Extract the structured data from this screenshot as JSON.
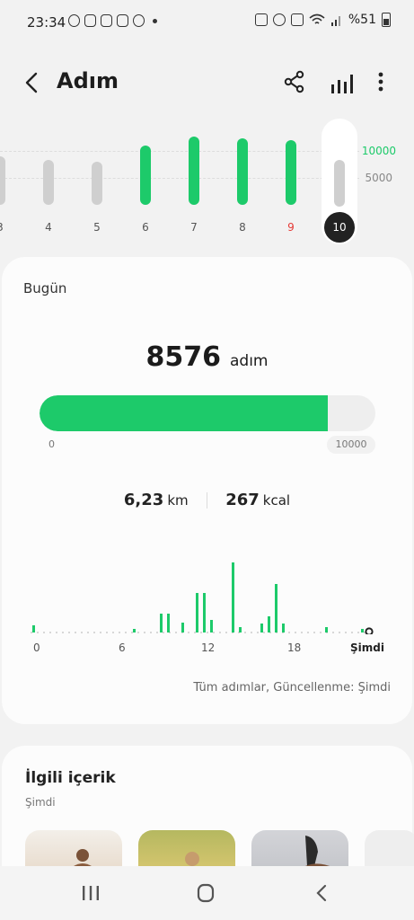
{
  "status_bar": {
    "time": "23:34",
    "battery": "%51"
  },
  "header": {
    "title": "Adım"
  },
  "weekly": {
    "days": [
      "3",
      "4",
      "5",
      "6",
      "7",
      "8",
      "9"
    ],
    "selected_day": "10",
    "goal_label_high": "10000",
    "goal_label_low": "5000",
    "accent": "#1dca6a",
    "red_day_color": "#e53935"
  },
  "today": {
    "label": "Bugün",
    "steps": "8576",
    "steps_unit": "adım",
    "progress_fraction": 0.8576,
    "progress_min": "0",
    "progress_max": "10000",
    "distance": "6,23",
    "distance_unit": "km",
    "calories": "267",
    "calories_unit": "kcal",
    "hour_labels": [
      "0",
      "6",
      "12",
      "18"
    ],
    "now_label": "Şimdi",
    "footer": "Tüm adımlar, Güncellenme: Şimdi"
  },
  "related": {
    "heading": "İlgili içerik",
    "subheading": "Şimdi"
  }
}
